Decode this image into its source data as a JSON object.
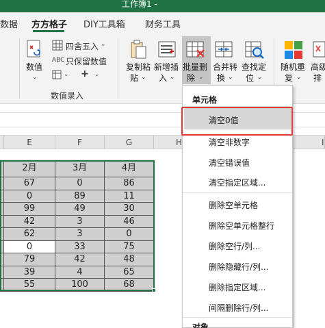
{
  "window": {
    "title": "工作簿1 -"
  },
  "tabs": [
    {
      "label": "数据",
      "active": false
    },
    {
      "label": "方方格子",
      "active": true
    },
    {
      "label": "DIY工具箱",
      "active": false
    },
    {
      "label": "财务工具",
      "active": false
    }
  ],
  "ribbon": {
    "number_btn": {
      "label": "数值"
    },
    "round_btn": {
      "label": "四舍五入"
    },
    "keep_numbers_btn": {
      "label": "只保留数值"
    },
    "plus_btn": {
      "label": "+"
    },
    "group_label": "数值录入",
    "copy_paste_btn": {
      "label_top": "复制粘",
      "label_bottom": "贴"
    },
    "insert_btn": {
      "label_top": "新增插",
      "label_bottom": "入"
    },
    "batch_delete_btn": {
      "label_top": "批量删",
      "label_bottom": "除"
    },
    "merge_btn": {
      "label_top": "合并转",
      "label_bottom": "换"
    },
    "find_btn": {
      "label_top": "查找定",
      "label_bottom": "位"
    },
    "random_btn": {
      "label_top": "随机重",
      "label_bottom": "复"
    },
    "advanced_btn": {
      "label_top": "高级",
      "label_bottom": "排"
    }
  },
  "sheet": {
    "columns": [
      "E",
      "F",
      "G",
      "H",
      "I"
    ],
    "headers": [
      "2月",
      "3月",
      "4月"
    ],
    "rows": [
      [
        "67",
        "0",
        "86"
      ],
      [
        "0",
        "89",
        "11"
      ],
      [
        "99",
        "49",
        "30"
      ],
      [
        "42",
        "3",
        "46"
      ],
      [
        "62",
        "3",
        "0"
      ],
      [
        "0",
        "33",
        "75"
      ],
      [
        "79",
        "42",
        "48"
      ],
      [
        "39",
        "4",
        "65"
      ],
      [
        "55",
        "100",
        "68"
      ]
    ],
    "white_cells": [
      [
        5,
        0
      ]
    ]
  },
  "menu": {
    "section1": "单元格",
    "items1": [
      "清空0值",
      "清空非数字",
      "清空错误值",
      "清空指定区域..."
    ],
    "items2": [
      "删除空单元格",
      "删除空单元格整行",
      "删除空行/列...",
      "删除隐藏行/列...",
      "删除指定区域...",
      "间隔删除行/列..."
    ],
    "section2": "对象"
  },
  "colors": {
    "accent": "#217346",
    "highlight_box": "#e53935"
  }
}
